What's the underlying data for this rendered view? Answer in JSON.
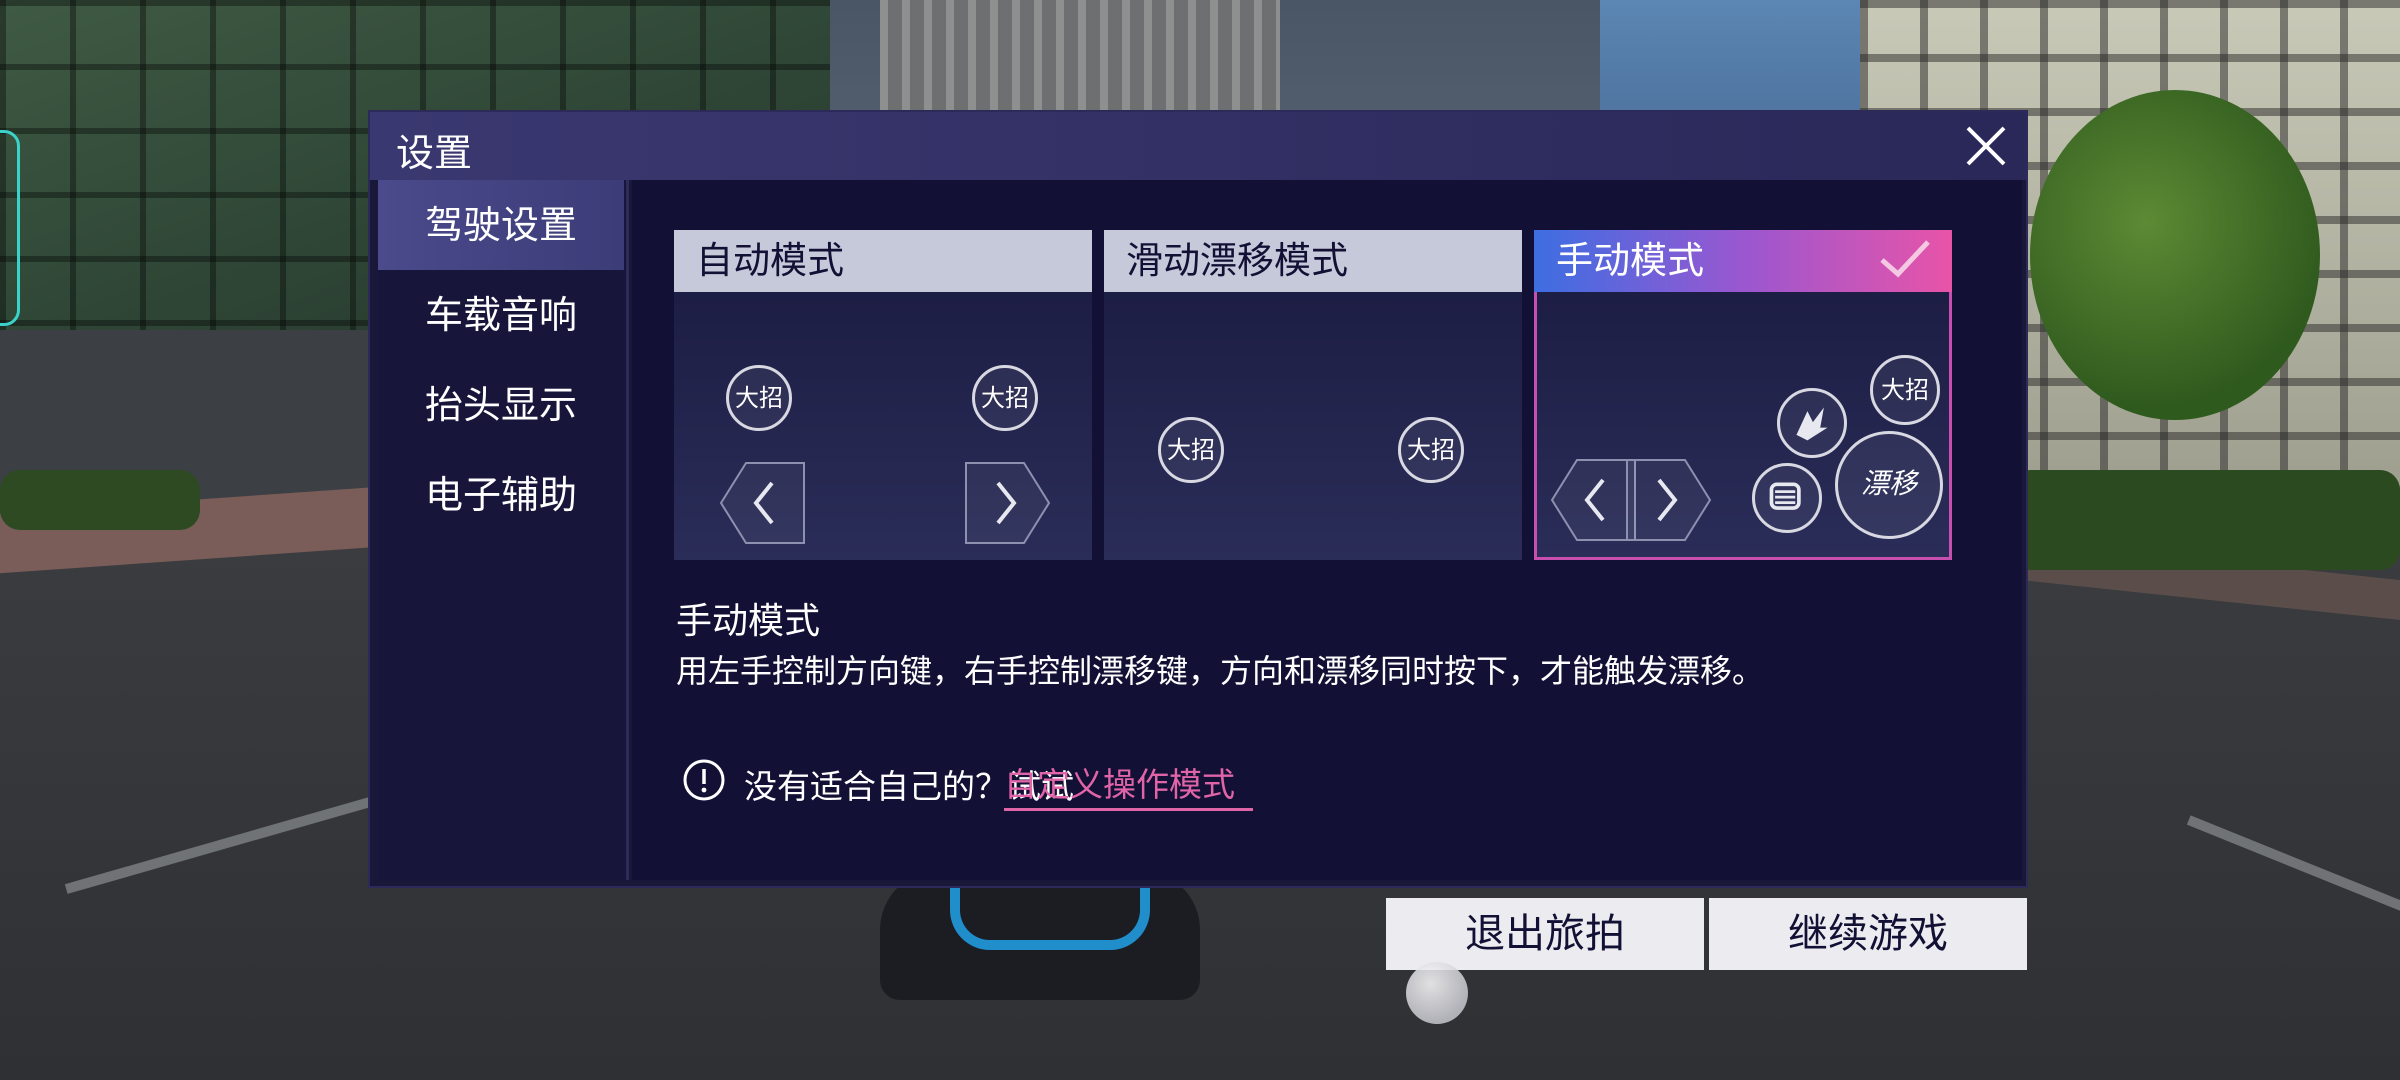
{
  "dialog": {
    "title": "设置",
    "close_icon": "close-icon"
  },
  "sidebar": {
    "items": [
      {
        "label": "驾驶设置",
        "active": true
      },
      {
        "label": "车载音响",
        "active": false
      },
      {
        "label": "抬头显示",
        "active": false
      },
      {
        "label": "电子辅助",
        "active": false
      }
    ]
  },
  "modes": [
    {
      "label": "自动模式",
      "selected": false,
      "buttons": [
        "大招",
        "大招"
      ]
    },
    {
      "label": "滑动漂移模式",
      "selected": false,
      "buttons": [
        "大招",
        "大招"
      ]
    },
    {
      "label": "手动模式",
      "selected": true,
      "buttons": [
        "大招",
        "漂移"
      ]
    }
  ],
  "description": {
    "title": "手动模式",
    "text": "用左手控制方向键，右手控制漂移键，方向和漂移同时按下，才能触发漂移。"
  },
  "hint": {
    "text": "没有适合自己的？试试",
    "link": "自定义操作模式",
    "icon": "info-icon"
  },
  "footer": {
    "exit_label": "退出旅拍",
    "continue_label": "继续游戏"
  },
  "colors": {
    "accent_pink": "#e064a8",
    "selected_gradient_start": "#3d6ee2",
    "selected_gradient_end": "#e854a8",
    "panel_bg": "#121034"
  }
}
